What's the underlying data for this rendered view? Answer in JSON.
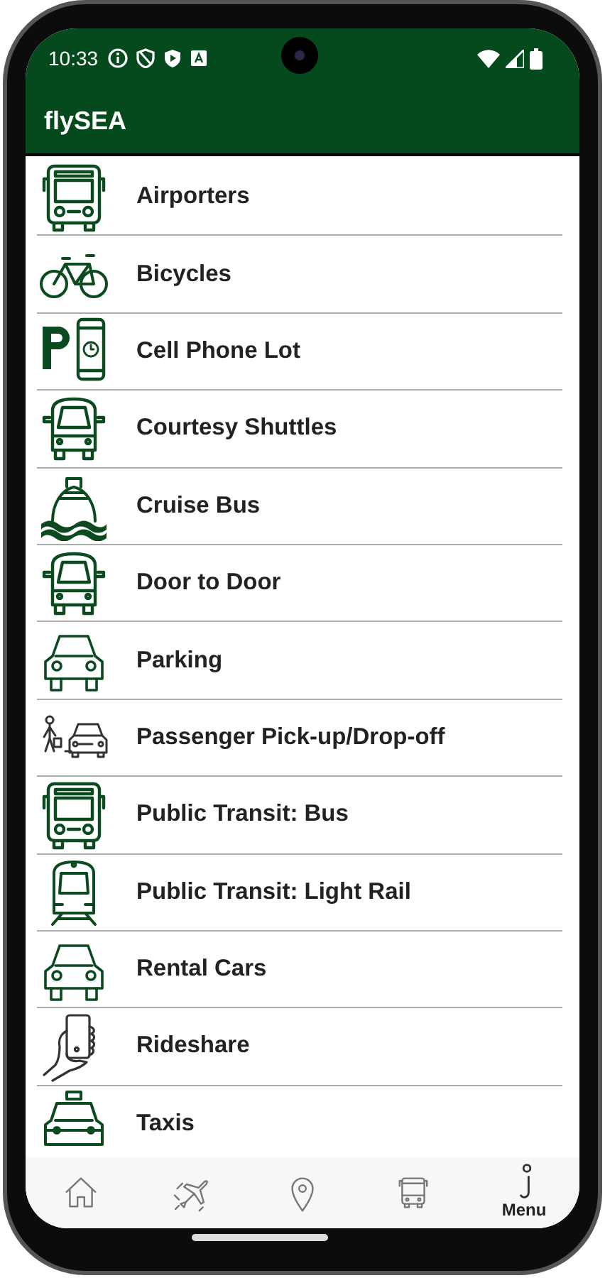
{
  "status_bar": {
    "time": "10:33"
  },
  "app_bar": {
    "title": "flySEA"
  },
  "list": [
    {
      "label": "Airporters",
      "kind": "bus"
    },
    {
      "label": "Bicycles",
      "kind": "bicycle"
    },
    {
      "label": "Cell Phone Lot",
      "kind": "phone-lot"
    },
    {
      "label": "Courtesy Shuttles",
      "kind": "van"
    },
    {
      "label": "Cruise Bus",
      "kind": "ship"
    },
    {
      "label": "Door to Door",
      "kind": "van"
    },
    {
      "label": "Parking",
      "kind": "car"
    },
    {
      "label": "Passenger Pick-up/Drop-off",
      "kind": "pickup"
    },
    {
      "label": "Public Transit: Bus",
      "kind": "bus"
    },
    {
      "label": "Public Transit: Light Rail",
      "kind": "train"
    },
    {
      "label": "Rental Cars",
      "kind": "car"
    },
    {
      "label": "Rideshare",
      "kind": "hand-phone"
    },
    {
      "label": "Taxis",
      "kind": "taxi"
    }
  ],
  "bottom_nav": [
    {
      "kind": "home",
      "selected": false
    },
    {
      "kind": "flight",
      "selected": false
    },
    {
      "kind": "location",
      "selected": false
    },
    {
      "kind": "bus",
      "selected": false
    },
    {
      "kind": "info",
      "label": "Menu",
      "selected": true
    }
  ]
}
